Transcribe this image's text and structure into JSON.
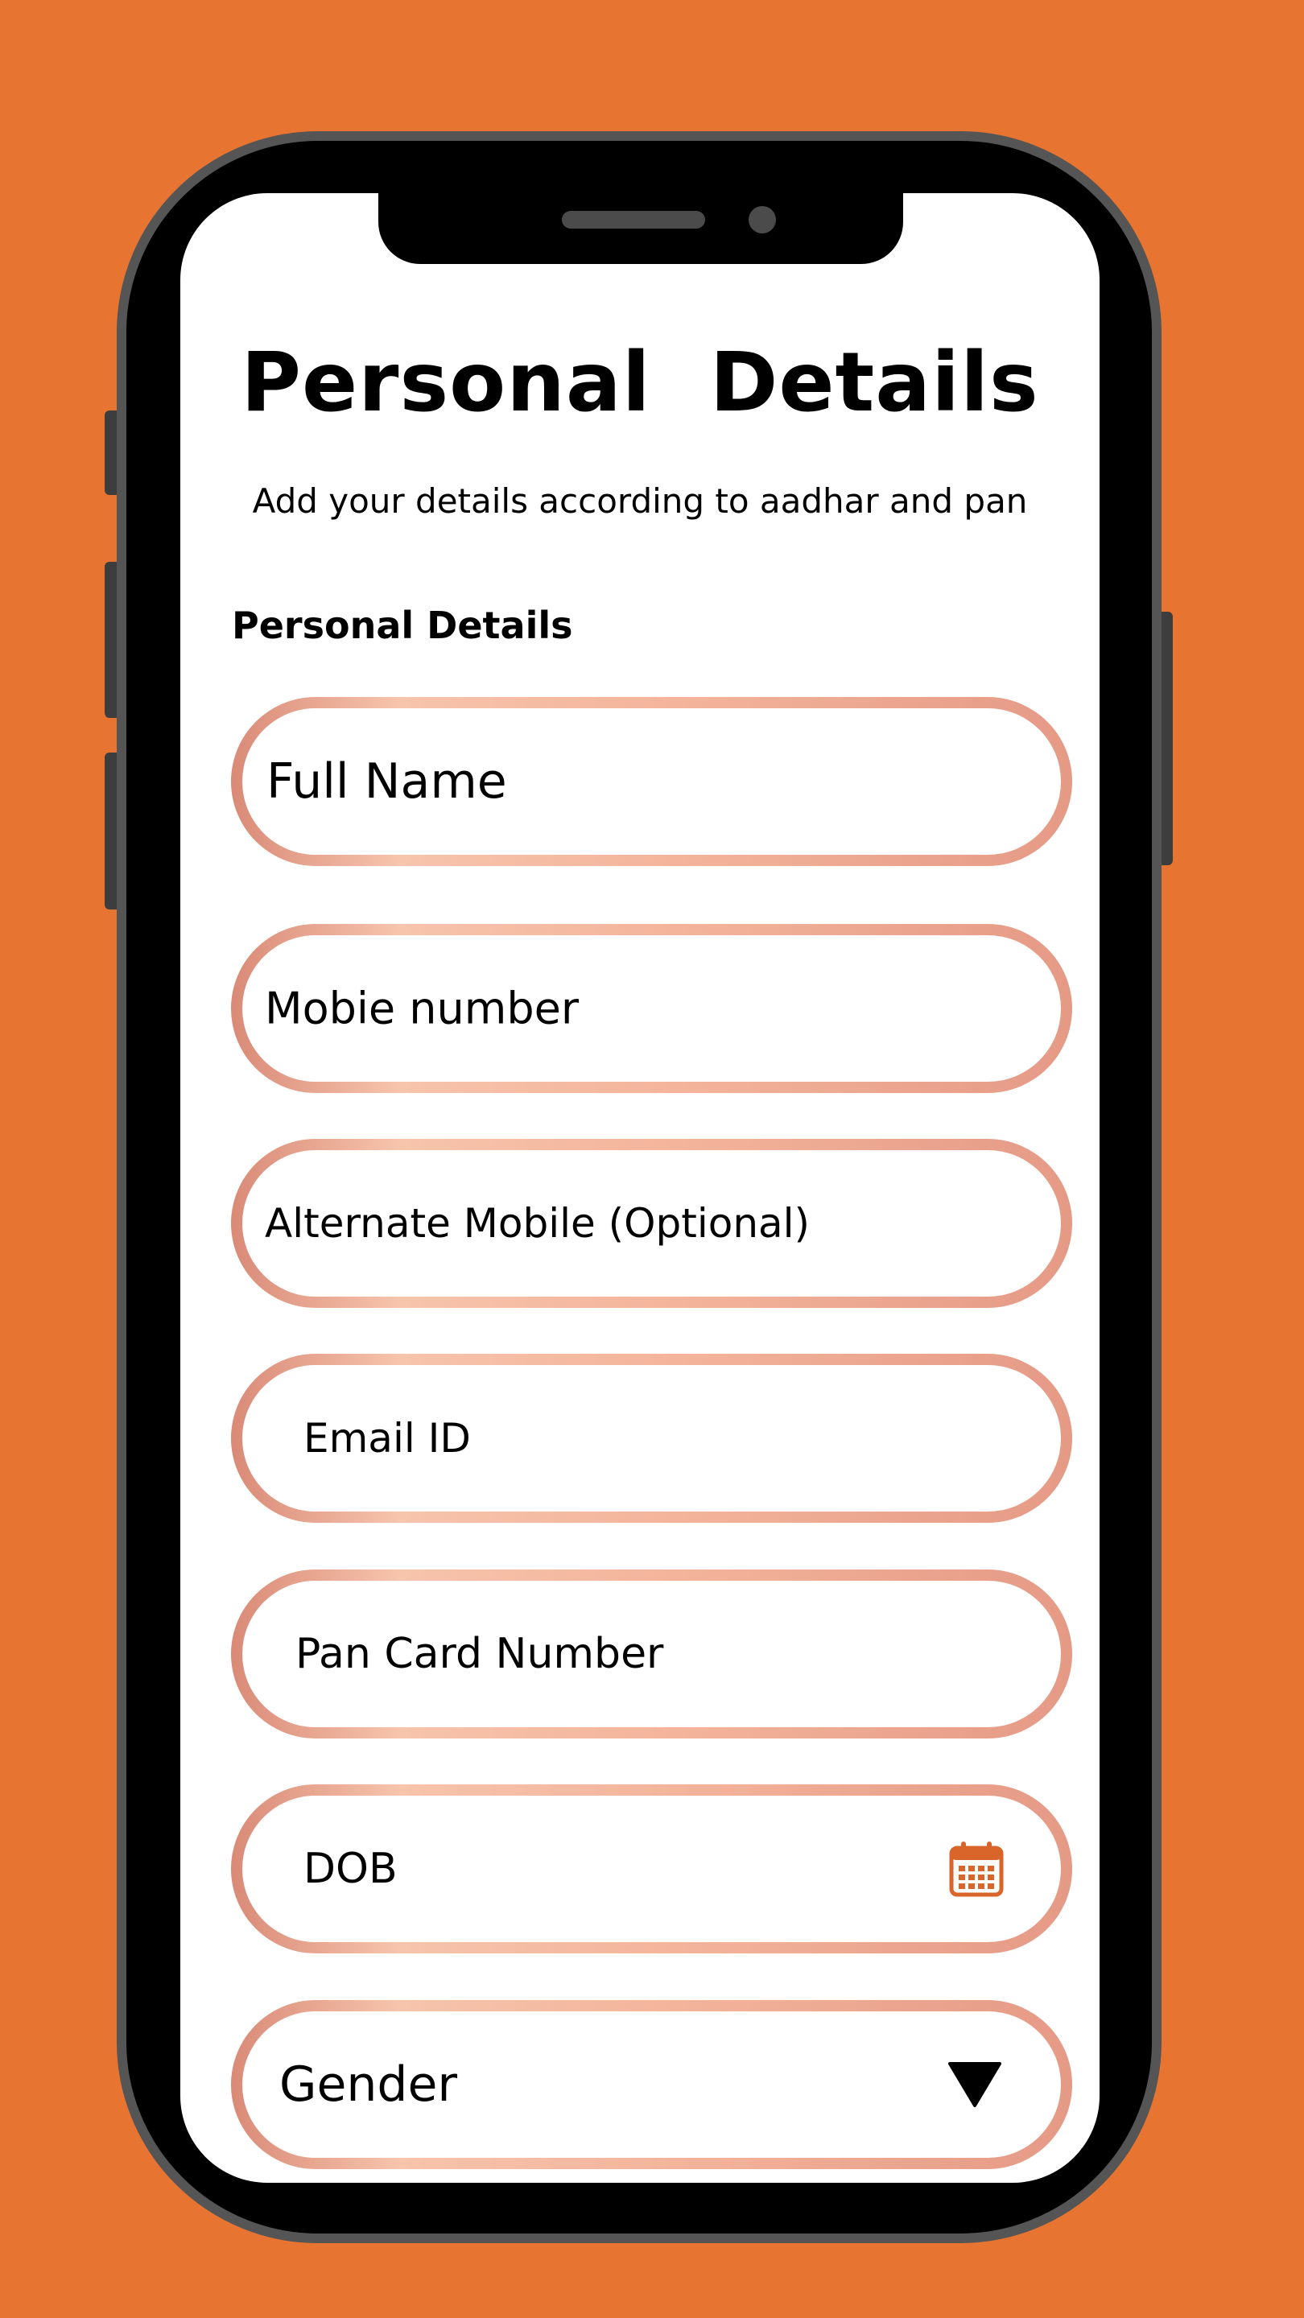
{
  "colors": {
    "background": "#E87431",
    "phone_frame": "#000000",
    "phone_bezel": "#555555",
    "screen": "#FFFFFF",
    "field_border_gradient": [
      "#D98A77",
      "#F7C4AC",
      "#F3B39A",
      "#E59A86"
    ],
    "calendar_icon": "#D9652A",
    "text": "#000000"
  },
  "header": {
    "title": "Personal  Details",
    "subtitle": "Add your details according to aadhar and pan"
  },
  "form": {
    "section_label": "Personal Details",
    "fields": [
      {
        "name": "full-name",
        "placeholder": "Full Name"
      },
      {
        "name": "mobile-number",
        "placeholder": "Mobie number"
      },
      {
        "name": "alternate-mobile",
        "placeholder": "Alternate Mobile (Optional)"
      },
      {
        "name": "email",
        "placeholder": "Email ID"
      },
      {
        "name": "pan-card-number",
        "placeholder": "Pan Card Number"
      },
      {
        "name": "dob",
        "placeholder": "DOB",
        "icon": "calendar-icon"
      },
      {
        "name": "gender",
        "placeholder": "Gender",
        "icon": "triangle-down-icon"
      }
    ]
  }
}
